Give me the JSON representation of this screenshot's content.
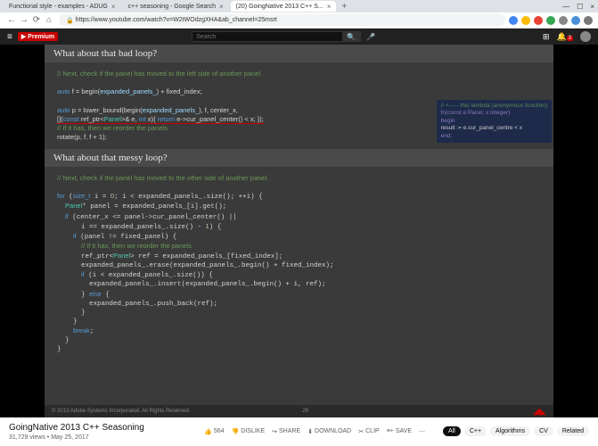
{
  "tabs": [
    {
      "title": "Functional style - examples - ADUG"
    },
    {
      "title": "c++ seasoning - Google Search"
    },
    {
      "title": "(20) GoingNative 2013 C++ S..."
    }
  ],
  "url": "https://www.youtube.com/watch?v=W2tWOdzgXHA&ab_channel=25msrt",
  "yt": {
    "logo": "Premium",
    "search_placeholder": "Search"
  },
  "slide": {
    "header1": "What about that bad loop?",
    "code1_c1": "// Next, check if the panel has moved to the left side of another panel.",
    "code1_l1a": "auto",
    "code1_l1b": " f = begin(",
    "code1_l1c": "expanded_panels_",
    "code1_l1d": ") + fixed_index;",
    "code1_l2a": "auto",
    "code1_l2b": " p = lower_bound(begin(",
    "code1_l2c": "expanded_panels_",
    "code1_l2d": "), f, center_x,",
    "code1_l3a": "    [](",
    "code1_l3b": "const",
    "code1_l3c": " ref_ptr<",
    "code1_l3d": "Panel",
    "code1_l3e": ">& e, ",
    "code1_l3f": "int",
    "code1_l3g": " x){ ",
    "code1_l3h": "return",
    "code1_l3i": " e->cur_panel_center() < x; });",
    "code1_c2": "// If it has, then we reorder the panels.",
    "code1_l4": "rotate(p, f, f + 1);",
    "tooltip": {
      "c": "// <----- this lambda (anonymous function)",
      "l1": "fn(const e:Panel; x:integer)",
      "l2": "begin",
      "l3": "    result := e.cur_panel_centre < x",
      "l4": "end;"
    },
    "header2": "What about that messy loop?",
    "code2_c1": "// Next, check if the panel has moved to the other side of another panel.",
    "code2": "for (size_t i = 0; i < expanded_panels_.size(); ++i) {\n  Panel* panel = expanded_panels_[i].get();\n  if (center_x <= panel->cur_panel_center() ||\n      i == expanded_panels_.size() - 1) {\n    if (panel != fixed_panel) {\n      // If it has, then we reorder the panels.\n      ref_ptr<Panel> ref = expanded_panels_[fixed_index];\n      expanded_panels_.erase(expanded_panels_.begin() + fixed_index);\n      if (i < expanded_panels_.size()) {\n        expanded_panels_.insert(expanded_panels_.begin() + i, ref);\n      } else {\n        expanded_panels_.push_back(ref);\n      }\n    }\n    break;\n  }\n}",
    "footer_copy": "© 2013 Adobe Systems Incorporated. All Rights Reserved.",
    "footer_page": "29"
  },
  "video": {
    "title": "GoingNative 2013 C++ Seasoning",
    "views": "31,729 views",
    "date": "May 25, 2017",
    "likes": "564",
    "dislike": "DISLIKE",
    "share": "SHARE",
    "download": "DOWNLOAD",
    "clip": "CLIP",
    "save": "SAVE"
  },
  "chips": [
    "All",
    "C++",
    "Algorithms",
    "CV",
    "Related"
  ]
}
